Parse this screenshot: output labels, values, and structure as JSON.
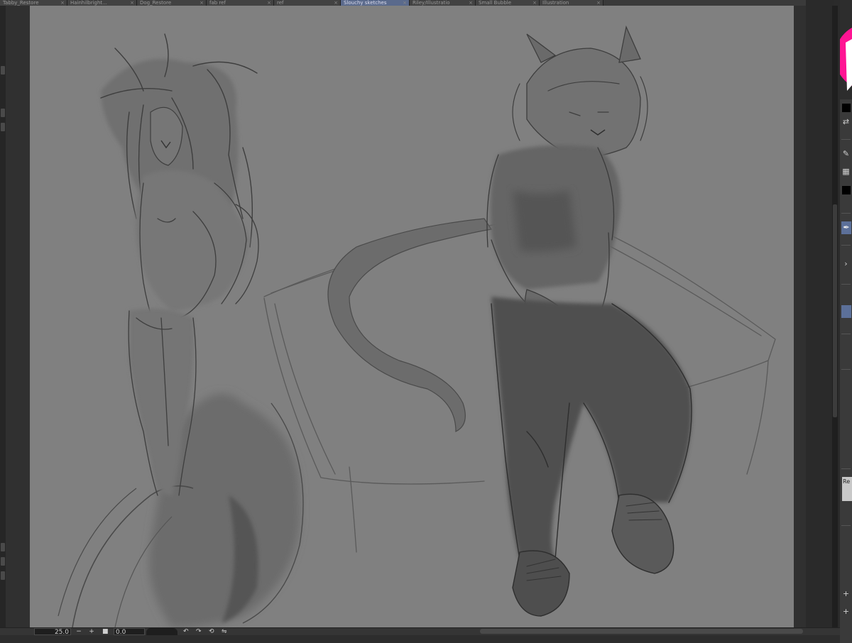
{
  "tabs": [
    {
      "label": "Tabby_Restore",
      "active": false
    },
    {
      "label": "Hainhilbright...",
      "active": false
    },
    {
      "label": "Dog_Restore",
      "active": false
    },
    {
      "label": "fab ref",
      "active": false
    },
    {
      "label": "ref",
      "active": false
    },
    {
      "label": "Slouchy sketches",
      "active": true
    },
    {
      "label": "Riley/Illustratio",
      "active": false
    },
    {
      "label": "Small Bubble",
      "active": false
    },
    {
      "label": "Illustration",
      "active": false
    }
  ],
  "statusbar": {
    "zoom_value": "25.0",
    "zoom_minus": "−",
    "zoom_plus": "+",
    "angle_value": "0.0",
    "rotate_left_icon": "rotate-left",
    "rotate_right_icon": "rotate-right",
    "reset_rotation_icon": "reset-rotation"
  },
  "right_column": {
    "layer_thumb_label": "Re",
    "plus_label": "+"
  },
  "canvas": {
    "paper_color": "#808080",
    "workspace_color": "#303030"
  },
  "colors": {
    "active_tab": "#5a6a8c",
    "selected_tool": "#5c7099"
  }
}
